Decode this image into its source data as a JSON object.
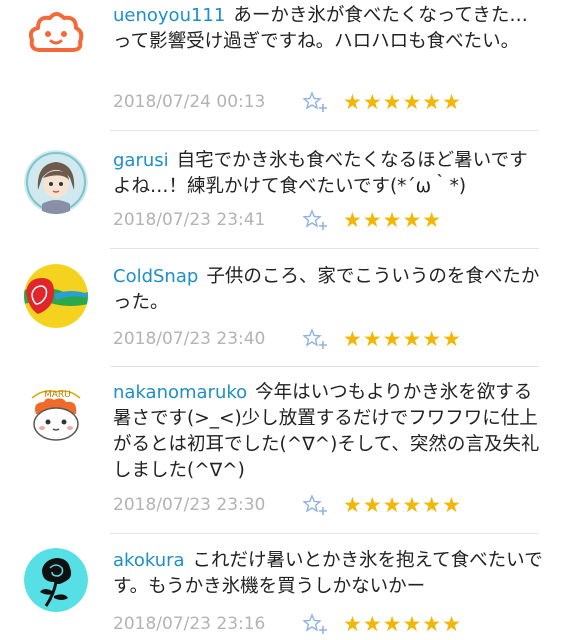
{
  "comments": [
    {
      "username": "uenoyou111",
      "text": "あーかき氷が食べたくなってきた…って影響受け過ぎですね。ハロハロも食べたい。",
      "date": "2018/07/24 00:13",
      "stars": "★★★★★★",
      "avatar": "cloud-face-icon"
    },
    {
      "username": "garusi",
      "text": "自宅でかき氷も食べたくなるほど暑いですよね…！練乳かけて食べたいです(*´ω｀*)",
      "date": "2018/07/23 23:41",
      "stars": "★★★★★",
      "avatar": "girl-avatar-icon"
    },
    {
      "username": "ColdSnap",
      "text": "子供のころ、家でこういうのを食べたかった。",
      "date": "2018/07/23 23:40",
      "stars": "★★★★★★",
      "avatar": "colorful-logo-icon"
    },
    {
      "username": "nakanomaruko",
      "text": "今年はいつもよりかき氷を欲する暑さです(>_<)少し放置するだけでフワフワに仕上がるとは初耳でした(^∇^)そして、突然の言及失礼しました(^∇^)",
      "date": "2018/07/23 23:30",
      "stars": "★★★★★★",
      "avatar": "maru-character-icon"
    },
    {
      "username": "akokura",
      "text": "これだけ暑いとかき氷を抱えて食べたいです。もうかき氷機を買うしかないかー",
      "date": "2018/07/23 23:16",
      "stars": "★★★★★★",
      "avatar": "rose-icon"
    }
  ],
  "colors": {
    "username": "#1c8fc9",
    "date": "#b3b3b3",
    "star": "#f2b705",
    "add_star": "#8fb3e0"
  },
  "icons": {
    "add_star": "add-star-icon"
  }
}
